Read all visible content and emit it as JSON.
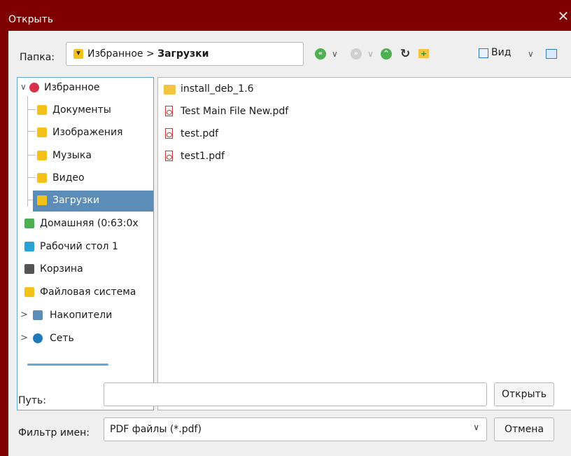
{
  "window": {
    "title": "Открыть",
    "close_glyph": "✕"
  },
  "toolbar": {
    "folder_label": "Папка:",
    "breadcrumb": {
      "root": "Избранное",
      "separator": ">",
      "current": "Загрузки"
    },
    "view_label": "Вид",
    "icons": [
      "back-icon",
      "dropdown-icon",
      "forward-icon",
      "dropdown-icon",
      "up-icon",
      "refresh-icon",
      "new-folder-icon",
      "view-icon",
      "dropdown-icon",
      "preview-icon"
    ]
  },
  "sidebar": {
    "items": [
      {
        "label": "Избранное",
        "icon": "favorites-heart-icon"
      },
      {
        "label": "Документы",
        "icon": "documents-icon"
      },
      {
        "label": "Изображения",
        "icon": "images-icon"
      },
      {
        "label": "Музыка",
        "icon": "music-icon"
      },
      {
        "label": "Видео",
        "icon": "video-icon"
      },
      {
        "label": "Загрузки",
        "icon": "downloads-icon",
        "selected": true
      },
      {
        "label": "Домашняя (0:63:0x",
        "icon": "home-icon"
      },
      {
        "label": "Рабочий стол 1",
        "icon": "desktop-icon"
      },
      {
        "label": "Корзина",
        "icon": "trash-icon"
      },
      {
        "label": "Файловая система",
        "icon": "filesystem-icon"
      },
      {
        "label": "Накопители",
        "icon": "drives-icon"
      },
      {
        "label": "Сеть",
        "icon": "network-icon"
      }
    ]
  },
  "files": [
    {
      "name": "install_deb_1.6",
      "type": "folder"
    },
    {
      "name": "Test Main File New.pdf",
      "type": "pdf"
    },
    {
      "name": "test.pdf",
      "type": "pdf"
    },
    {
      "name": "test1.pdf",
      "type": "pdf"
    }
  ],
  "footer": {
    "path_label": "Путь:",
    "path_value": "",
    "open_button": "Открыть",
    "filter_label": "Фильтр имен:",
    "filter_value": "PDF файлы (*.pdf)",
    "cancel_button": "Отмена"
  },
  "colors": {
    "titlebar": "#7e0000",
    "selected": "#5b8db8",
    "accent": "#5fa8de"
  }
}
